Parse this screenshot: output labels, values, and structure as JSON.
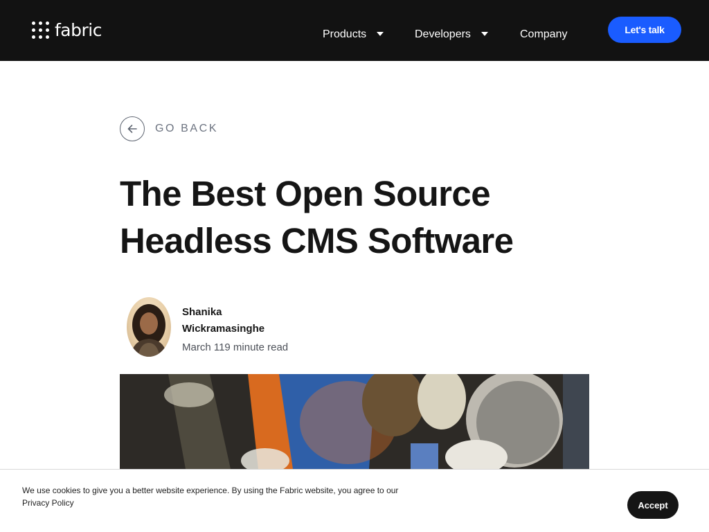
{
  "header": {
    "logo_text": "fabric",
    "nav": [
      {
        "label": "Products",
        "has_dropdown": true
      },
      {
        "label": "Developers",
        "has_dropdown": true
      },
      {
        "label": "Company",
        "has_dropdown": false
      }
    ],
    "cta_label": "Let's talk"
  },
  "article": {
    "back_label": "GO BACK",
    "title_line1": "The Best Open Source",
    "title_line2": "Headless CMS Software",
    "author_first": "Shanika",
    "author_last": "Wickramasinghe",
    "meta": "March 119 minute read"
  },
  "cookie": {
    "text": "We use cookies to give you a better website experience. By using the Fabric website, you agree to our",
    "link_label": "Privacy Policy",
    "accept_label": "Accept"
  },
  "colors": {
    "header_bg": "#121212",
    "accent": "#1a5cff",
    "text": "#151515",
    "muted": "#6c7380"
  },
  "icons": [
    "logo-dots-icon",
    "chevron-down-icon",
    "arrow-left-icon"
  ]
}
